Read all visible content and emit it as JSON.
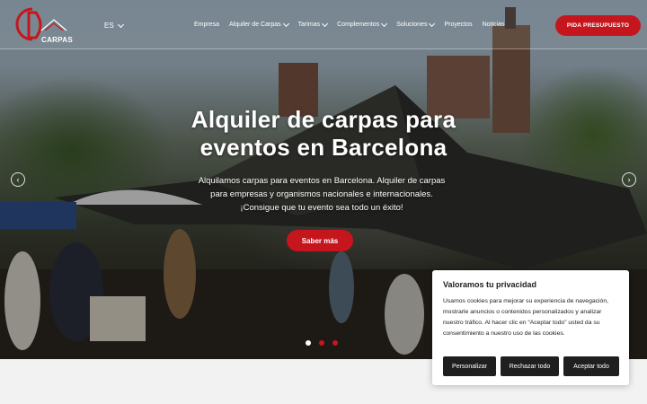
{
  "header": {
    "logo_text": "CARPAS",
    "language": "ES",
    "nav": [
      {
        "label": "Empresa",
        "dropdown": false
      },
      {
        "label": "Alquiler de Carpas",
        "dropdown": true
      },
      {
        "label": "Tarimas",
        "dropdown": true
      },
      {
        "label": "Complementos",
        "dropdown": true
      },
      {
        "label": "Soluciones",
        "dropdown": true
      },
      {
        "label": "Proyectos",
        "dropdown": false
      },
      {
        "label": "Noticias",
        "dropdown": false
      }
    ],
    "cta_label": "PIDA PRESUPUESTO"
  },
  "hero": {
    "title_line1": "Alquiler de carpas para",
    "title_line2": "eventos en Barcelona",
    "subtitle_line1": "Alquilamos carpas para eventos en Barcelona. Alquiler de carpas",
    "subtitle_line2": "para empresas y organismos nacionales e internacionales.",
    "subtitle_line3": "¡Consigue que tu evento sea todo un éxito!",
    "button_label": "Saber más",
    "prev_icon": "chevron-left-icon",
    "next_icon": "chevron-right-icon",
    "slides": 3,
    "active_slide": 1
  },
  "cookie": {
    "title": "Valoramos tu privacidad",
    "text": "Usamos cookies para mejorar su experiencia de navegación, mostrarle anuncios o contenidos personalizados y analizar nuestro tráfico. Al hacer clic en “Aceptar todo” usted da su consentimiento a nuestro uso de las cookies.",
    "buttons": {
      "customize": "Personalizar",
      "reject": "Rechazar todo",
      "accept": "Aceptar todo"
    }
  },
  "colors": {
    "brand_red": "#c5161d",
    "dot_active": "#ffffff",
    "dot_inactive": "#c5161d",
    "cookie_button": "#1f1f1f"
  }
}
